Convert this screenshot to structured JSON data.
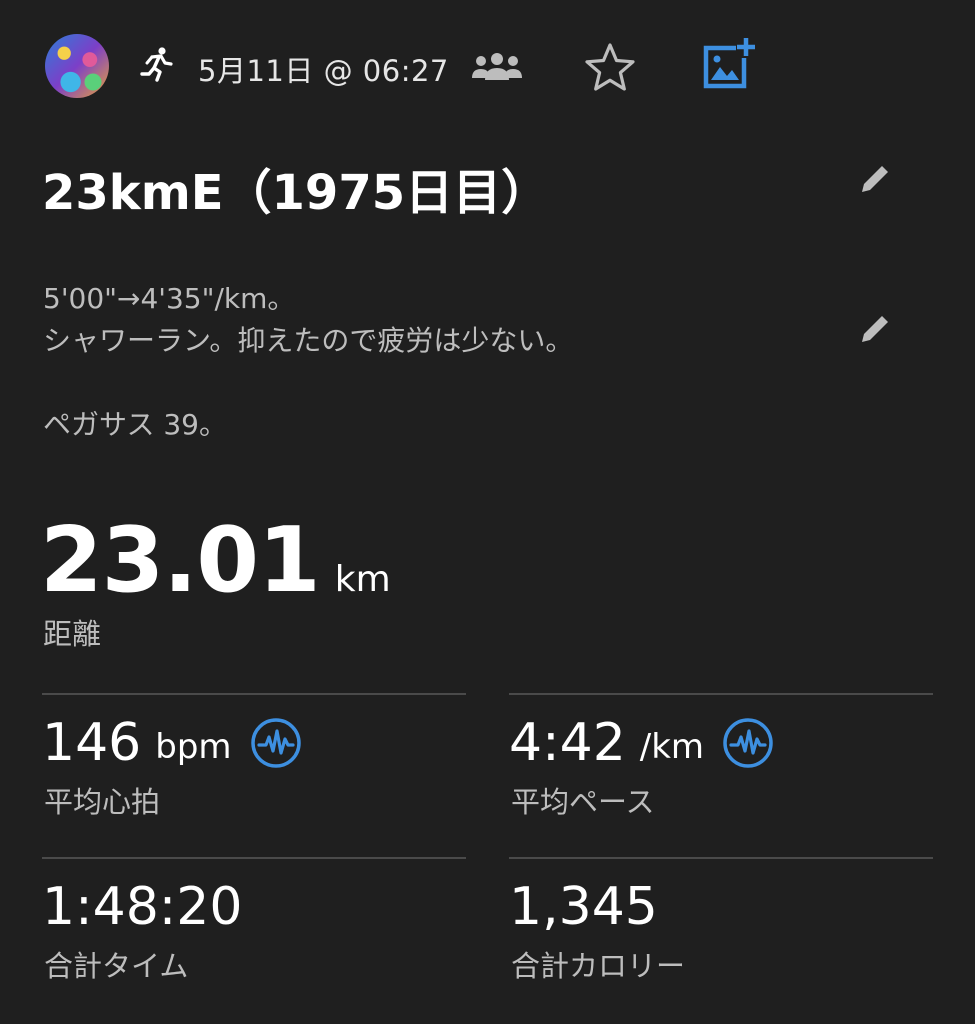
{
  "header": {
    "activity_icon": "running-person-icon",
    "date_time": "5月11日 @ 06:27",
    "icons": [
      "group-icon",
      "star-icon",
      "add-photo-icon"
    ],
    "accent_color": "#3d8fe0"
  },
  "activity": {
    "title": "23kmE（1975日目）",
    "notes": [
      "5'00\"→4'35\"/km。",
      "シャワーラン。抑えたので疲労は少ない。",
      "",
      "ペガサス 39。"
    ]
  },
  "distance": {
    "value": "23.01",
    "unit": "km",
    "label": "距離"
  },
  "stats": [
    {
      "value": "146",
      "unit": "bpm",
      "label": "平均心拍",
      "has_chart_icon": true
    },
    {
      "value": "4:42",
      "unit": "/km",
      "label": "平均ペース",
      "has_chart_icon": true
    },
    {
      "value": "1:48:20",
      "unit": "",
      "label": "合計タイム",
      "has_chart_icon": false
    },
    {
      "value": "1,345",
      "unit": "",
      "label": "合計カロリー",
      "has_chart_icon": false
    }
  ]
}
